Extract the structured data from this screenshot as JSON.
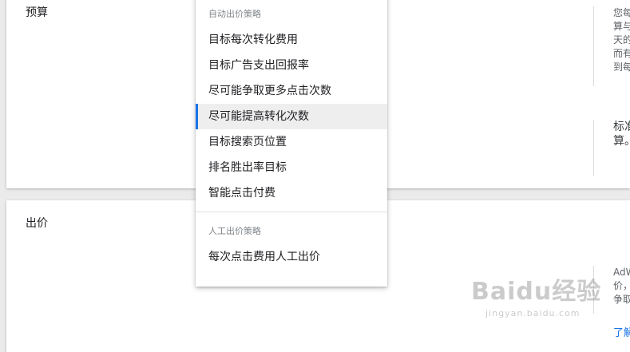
{
  "budget_card": {
    "title": "预算",
    "help_text_1": "您每\n算与\n天的\n而有\n到每",
    "help_text_2": "标准\n算。"
  },
  "bid_card": {
    "title": "出价",
    "help_text_1": "AdW\n价，\n争取",
    "learn_more": "了解"
  },
  "bidding_menu": {
    "auto_header": "自动出价策略",
    "auto_items": [
      "目标每次转化费用",
      "目标广告支出回报率",
      "尽可能争取更多点击次数",
      "尽可能提高转化次数",
      "目标搜索页位置",
      "排名胜出率目标",
      "智能点击付费"
    ],
    "selected_item": "尽可能提高转化次数",
    "manual_header": "人工出价策略",
    "manual_items": [
      "每次点击费用人工出价"
    ]
  },
  "watermark": {
    "logo": "Baidu经验",
    "url": "jingyan.baidu.com"
  },
  "colors": {
    "accent": "#1a73e8",
    "selected_bg": "#eeeeee",
    "page_bg": "#ebebeb"
  }
}
